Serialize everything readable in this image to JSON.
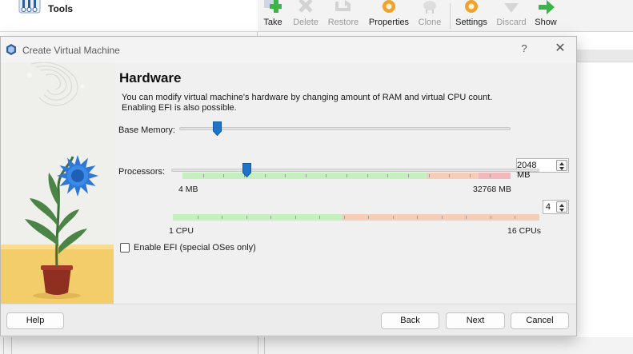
{
  "background": {
    "tools_label": "Tools",
    "toolbar": [
      {
        "label": "Take",
        "icon": "take-snapshot-icon",
        "enabled": true
      },
      {
        "label": "Delete",
        "icon": "delete-snapshot-icon",
        "enabled": false
      },
      {
        "label": "Restore",
        "icon": "restore-snapshot-icon",
        "enabled": false
      },
      {
        "label": "Properties",
        "icon": "properties-gear-icon",
        "enabled": true
      },
      {
        "label": "Clone",
        "icon": "clone-sheep-icon",
        "enabled": false
      },
      {
        "label": "Settings",
        "icon": "settings-gear-icon",
        "enabled": true
      },
      {
        "label": "Discard",
        "icon": "discard-arrow-icon",
        "enabled": false
      },
      {
        "label": "Show",
        "icon": "show-arrow-icon",
        "enabled": true
      }
    ]
  },
  "dialog": {
    "title": "Create Virtual Machine",
    "help_glyph": "?",
    "close_glyph": "✕",
    "heading": "Hardware",
    "description_line1": "You can modify virtual machine's hardware by changing amount of RAM and virtual CPU count.",
    "description_line2": "Enabling EFI is also possible.",
    "memory": {
      "label": "Base Memory:",
      "value_text": "2048 MB",
      "min_label": "4 MB",
      "max_label": "32768 MB",
      "value_mb": 2048,
      "min_mb": 4,
      "max_mb": 32768
    },
    "processors": {
      "label": "Processors:",
      "value_text": "4",
      "min_label": "1 CPU",
      "max_label": "16 CPUs",
      "value": 4,
      "min": 1,
      "max": 16
    },
    "efi": {
      "label": "Enable EFI (special OSes only)",
      "checked": false
    },
    "buttons": {
      "help": "Help",
      "back": "Back",
      "next": "Next",
      "cancel": "Cancel"
    }
  },
  "colors": {
    "slider_thumb": "#1f74c9",
    "scale_green": "#c6efc0",
    "scale_orange": "#f6cdb7",
    "scale_red": "#f2b9bd"
  }
}
